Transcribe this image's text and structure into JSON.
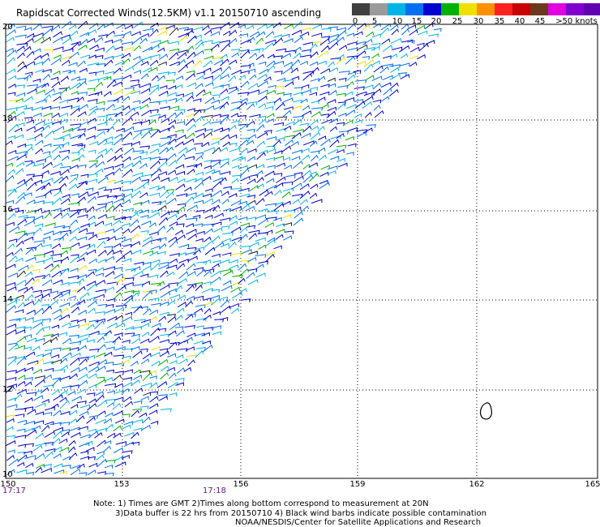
{
  "title": "Rapidscat Corrected Winds(12.5KM) v1.1 20150710 ascending",
  "legend": {
    "labels": [
      "0",
      "5",
      "10",
      "15",
      "20",
      "25",
      "30",
      "35",
      "40",
      "45",
      ">50 knots"
    ],
    "colors": [
      "#404040",
      "#9a9a9a",
      "#00b4e6",
      "#0070f0",
      "#0000d0",
      "#00b000",
      "#f0e000",
      "#ff9000",
      "#ff2020",
      "#c80000",
      "#6b3a1e",
      "#e000e0",
      "#8000d0",
      "#6000b0"
    ]
  },
  "axes": {
    "lat_labels": [
      "20",
      "18",
      "16",
      "14",
      "12",
      "10"
    ],
    "lon_labels": [
      "150",
      "153",
      "156",
      "159",
      "162",
      "165"
    ]
  },
  "times": [
    "17:17",
    "17:18"
  ],
  "notes": [
    "Note: 1) Times are GMT 2)Times along bottom correspond to measurement at 20N",
    "3)Data buffer is 22 hrs from 20150710 4) Black wind barbs indicate possible contamination",
    "NOAA/NESDIS/Center for Satellite Applications and Research"
  ]
}
